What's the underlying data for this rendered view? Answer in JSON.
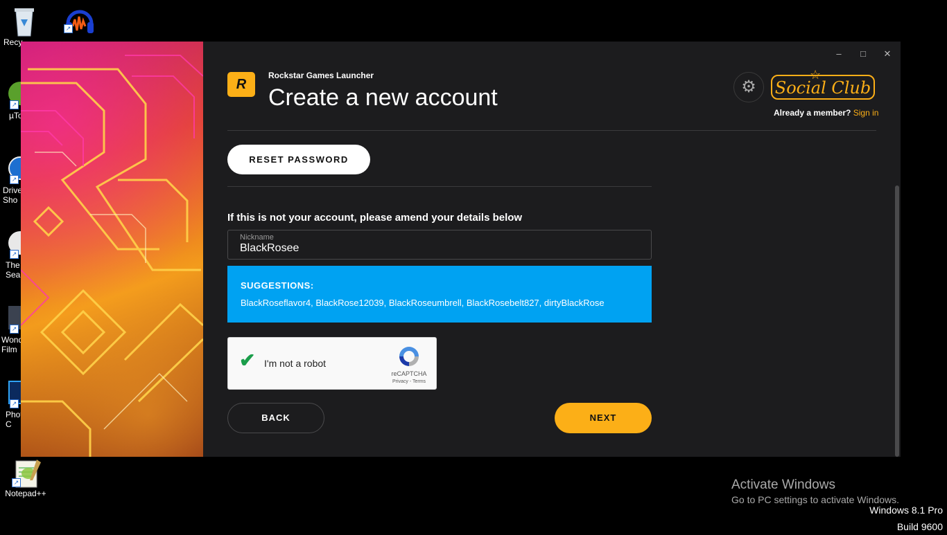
{
  "desktop": {
    "icons": [
      {
        "label": "Recy",
        "icon": "recycle-bin-icon"
      },
      {
        "label": "",
        "icon": "audacity-icon"
      },
      {
        "label": "µTo",
        "icon": "utorrent-icon"
      },
      {
        "label": "Drive\nSho",
        "icon": "drive-icon"
      },
      {
        "label": "The\nSea",
        "icon": "app-icon"
      },
      {
        "label": "Wond\nFilm",
        "icon": "filmora-icon"
      },
      {
        "label": "Phot\nC",
        "icon": "photoshop-icon"
      },
      {
        "label": "Notepad++",
        "icon": "notepadpp-icon"
      }
    ],
    "activation": {
      "title": "Activate Windows",
      "subtitle": "Go to PC settings to activate Windows."
    },
    "os": {
      "edition": "Windows 8.1 Pro",
      "build": "Build 9600"
    }
  },
  "launcher": {
    "app_title": "Rockstar Games Launcher",
    "page_title": "Create a new account",
    "logo_text": "R",
    "social_club_text": "Social Club",
    "already_member": "Already a member?",
    "sign_in": "Sign in",
    "window_controls": {
      "minimize": "–",
      "maximize": "□",
      "close": "✕"
    },
    "reset_password": "RESET PASSWORD",
    "section_heading": "If this is not your account, please amend your details below",
    "nickname": {
      "label": "Nickname",
      "value": "BlackRosee"
    },
    "suggestions": {
      "heading": "SUGGESTIONS:",
      "list": "BlackRoseflavor4, BlackRose12039, BlackRoseumbrell, BlackRosebelt827, dirtyBlackRose"
    },
    "recaptcha": {
      "label": "I'm not a robot",
      "brand": "reCAPTCHA",
      "terms": "Privacy - Terms",
      "checked": true
    },
    "back": "BACK",
    "next": "NEXT",
    "accent_color": "#fcaf17",
    "suggestion_color": "#00a2f2"
  }
}
